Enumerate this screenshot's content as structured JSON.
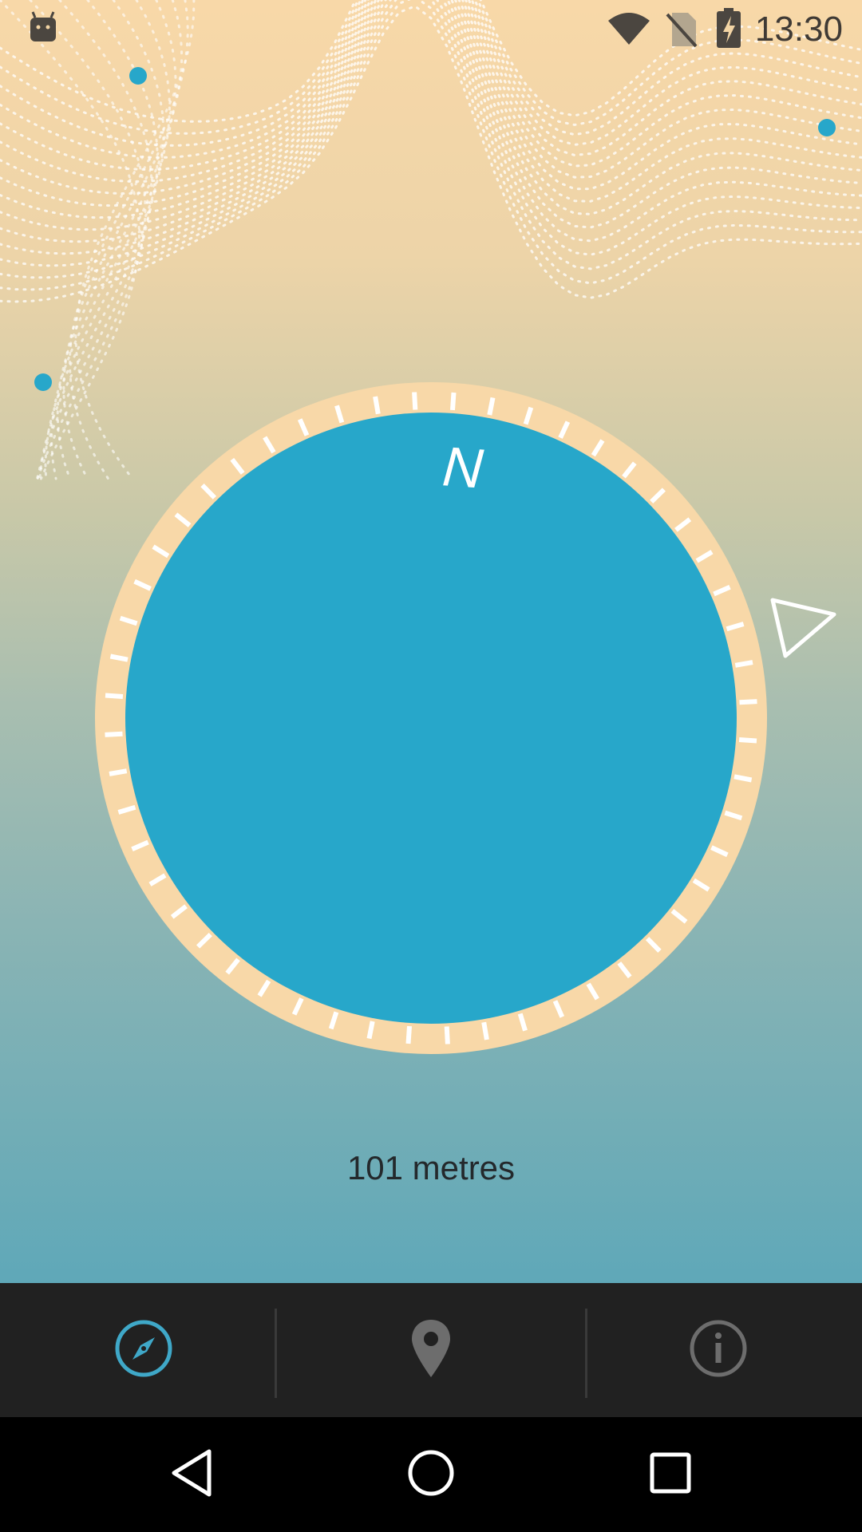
{
  "status_bar": {
    "time": "13:30",
    "icons": [
      "android-notification-icon",
      "wifi-icon",
      "no-sim-icon",
      "battery-charging-icon"
    ]
  },
  "compass": {
    "north_label": "N",
    "colors": {
      "dial": "#27A7CA",
      "ring": "#F8D8A8",
      "ticks": "#FFFFFF"
    },
    "pointer_icon": "direction-triangle-icon"
  },
  "distance": {
    "text": "101 metres"
  },
  "bottom_nav": {
    "items": [
      {
        "icon": "compass-icon",
        "active": true,
        "color": "#3FA8C8"
      },
      {
        "icon": "location-pin-icon",
        "active": false,
        "color": "#6d6d6d"
      },
      {
        "icon": "info-icon",
        "active": false,
        "color": "#6d6d6d"
      }
    ]
  },
  "system_nav": {
    "buttons": [
      "back-icon",
      "home-icon",
      "recents-icon"
    ]
  }
}
